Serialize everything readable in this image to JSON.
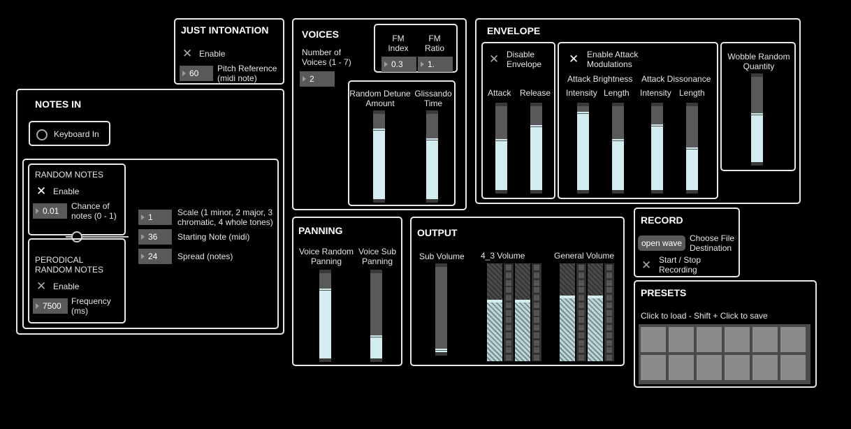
{
  "just_intonation": {
    "title": "JUST INTONATION",
    "enable_label": "Enable",
    "pitch_ref_value": "60",
    "pitch_ref_label": "Pitch Reference (midi note)"
  },
  "notes_in": {
    "title": "NOTES IN",
    "keyboard_label": "Keyboard In",
    "random_notes": {
      "title": "RANDOM NOTES",
      "enable_label": "Enable",
      "chance_value": "0.01",
      "chance_label": "Chance of notes (0 - 1)"
    },
    "periodic": {
      "title": "PERODICAL RANDOM NOTES",
      "enable_label": "Enable",
      "frequency_value": "7500",
      "frequency_label": "Frequency (ms)"
    },
    "scale_value": "1",
    "scale_label": "Scale (1 minor, 2 major, 3 chromatic, 4 whole tones)",
    "starting_note_value": "36",
    "starting_note_label": "Starting Note (midi)",
    "spread_value": "24",
    "spread_label": "Spread (notes)"
  },
  "voices": {
    "title": "VOICES",
    "num_voices_label": "Number of Voices (1 - 7)",
    "num_voices_value": "2",
    "fm_index_label": "FM Index",
    "fm_index_value": "0.3",
    "fm_ratio_label": "FM Ratio",
    "fm_ratio_value": "1.",
    "detune_label": "Random Detune Amount",
    "detune_level": 0.84,
    "glissando_label": "Glissando Time",
    "glissando_level": 0.72
  },
  "envelope": {
    "title": "ENVELOPE",
    "disable_label": "Disable Envelope",
    "attack_label": "Attack",
    "attack_level": 0.62,
    "release_label": "Release",
    "release_level": 0.78,
    "enable_mod_label": "Enable Attack Modulations",
    "brightness_label": "Attack Brightness",
    "dissonance_label": "Attack Dissonance",
    "intensity_label": "Intensity",
    "length_label": "Length",
    "bright_intensity_level": 0.94,
    "bright_length_level": 0.62,
    "diss_intensity_level": 0.79,
    "diss_length_level": 0.52,
    "wobble_label": "Wobble Random Quantity",
    "wobble_level": 0.58
  },
  "panning": {
    "title": "PANNING",
    "voice_random_label": "Voice Random Panning",
    "voice_random_level": 0.83,
    "voice_sub_label": "Voice Sub Panning",
    "voice_sub_level": 0.28
  },
  "output": {
    "title": "OUTPUT",
    "sub_volume_label": "Sub Volume",
    "sub_volume_level": 0.05,
    "volume_43_label": "4_3 Volume",
    "volume_43_level": 0.63,
    "general_volume_label": "General Volume",
    "general_volume_level": 0.67
  },
  "record": {
    "title": "RECORD",
    "open_wave_label": "open wave",
    "choose_file_label": "Choose File Destination",
    "start_stop_label": "Start / Stop Recording"
  },
  "presets": {
    "title": "PRESETS",
    "hint": "Click to load - Shift + Click to save"
  }
}
